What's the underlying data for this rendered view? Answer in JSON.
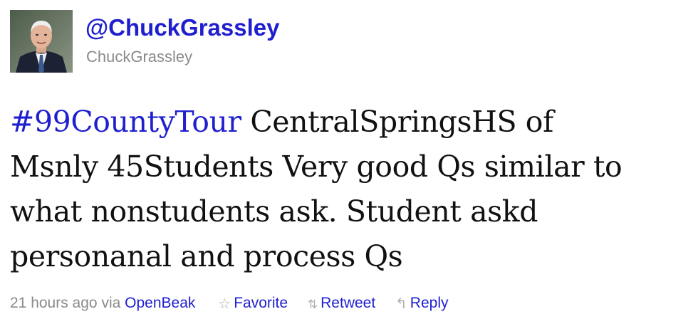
{
  "user": {
    "screen_name": "@ChuckGrassley",
    "full_name": "ChuckGrassley"
  },
  "tweet": {
    "hashtag": "#99CountyTour",
    "line1_rest": " CentralSpringsHS of",
    "line2": "Msnly 45Students Very good Qs similar to",
    "line3": "what nonstudents ask. Student askd",
    "line4": "personanal and process Qs"
  },
  "meta": {
    "time_text": "21 hours ago",
    "via_text": "via",
    "source": "OpenBeak"
  },
  "actions": {
    "favorite": {
      "label": "Favorite",
      "icon": "star-icon"
    },
    "retweet": {
      "label": "Retweet",
      "icon": "retweet-icon"
    },
    "reply": {
      "label": "Reply",
      "icon": "reply-icon"
    }
  },
  "colors": {
    "link": "#1f1fcf",
    "text": "#111111",
    "muted": "#8a8a8a"
  }
}
